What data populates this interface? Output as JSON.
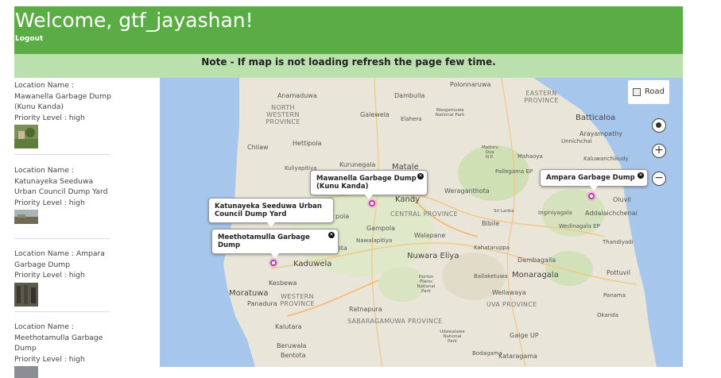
{
  "header": {
    "welcome": "Welcome, gtf_jayashan!",
    "logout": "Logout"
  },
  "note": "Note - If map is not loading refresh the page few time.",
  "locations": [
    {
      "name": "Location Name : Mawanella Garbage Dump (Kunu Kanda)",
      "priority": "Priority Level : high"
    },
    {
      "name": "Location Name : Katunayeka Seeduwa Urban Council Dump Yard",
      "priority": "Priority Level : high"
    },
    {
      "name": "Location Name : Ampara Garbage Dump",
      "priority": "Priority Level : high"
    },
    {
      "name": "Location Name : Meethotamulla Garbage Dump",
      "priority": "Priority Level : high"
    }
  ],
  "map": {
    "road_label": "Road",
    "popups": {
      "mawanella": "Mawanella Garbage Dump (Kunu Kanda)",
      "katunayeka": "Katunayeka Seeduwa Urban Council Dump Yard",
      "meethotamulla": "Meethotamulla Garbage Dump",
      "ampara": "Ampara Garbage Dump"
    },
    "labels": {
      "polonnaruwa": "Polonnaruwa",
      "anamaduwa": "Anamaduwa",
      "dambulla": "Dambulla",
      "eastern": "EASTERN PROVINCE",
      "northwestern": "NORTH WESTERN PROVINCE",
      "galewela": "Galewela",
      "elahera": "Elahera",
      "wasgamuwa": "Wasgamuwa National Park",
      "batticaloa": "Batticaloa",
      "arayampathy": "Arayampathy",
      "unnichchai": "Unnichchai",
      "chilaw": "Chilaw",
      "hettipola": "Hettipola",
      "maduru": "Maduru Oya N.P.",
      "mahaoya": "Mahaoya",
      "kaluwanchikudy": "Kaluwanchikudy",
      "kuliyapitiya": "Kuliyapitiya",
      "kurunegala": "Kurunegala",
      "matale": "Matale",
      "pallegama": "Pallegama EP",
      "kandy": "Kandy",
      "weraganthota": "Weraganthota",
      "oluvil": "Oluvil",
      "central": "CENTRAL PROVINCE",
      "srilanka": "Sri Lanka",
      "bibile": "Bibile",
      "inginiyagala": "Inginiyagala",
      "addalaichchenai": "Addalaichchenai",
      "wedinagala": "Wedinagala EP",
      "gampola": "Gampola",
      "walapane": "Walapane",
      "thandiyadi": "Thandiyadi",
      "nawalapitiya": "Nawalapitiya",
      "yantota": "yantota",
      "kahataruppa": "Kahataruppa",
      "nuwaraeliya": "Nuwara Eliya",
      "kaduwela": "Kaduwela",
      "dambagalla": "Dambagalla",
      "horton": "Horton Plains National Park",
      "ballaketuwa": "Ballaketuwa",
      "monaragala": "Monaragala",
      "pottuvil": "Pottuvil",
      "kesbewa": "Kesbewa",
      "moratuwa": "Moratuwa",
      "western": "WESTERN PROVINCE",
      "panadura": "Panadura",
      "wellawaya": "Wellawaya",
      "panama": "Panama",
      "uva": "UVA PROVINCE",
      "ratnapura": "Ratnapura",
      "okanda": "Okanda",
      "sabaragamuwa": "SABARAGAMUWA PROVINCE",
      "kalutara": "Kalutara",
      "udawalawe": "Udawalawe National Park",
      "galgeup": "Galge UP",
      "beruwala": "Beruwala",
      "bentota": "Bentota",
      "bodagama": "Bodagama",
      "kataragama": "Kataragama",
      "pola": "pola"
    }
  }
}
